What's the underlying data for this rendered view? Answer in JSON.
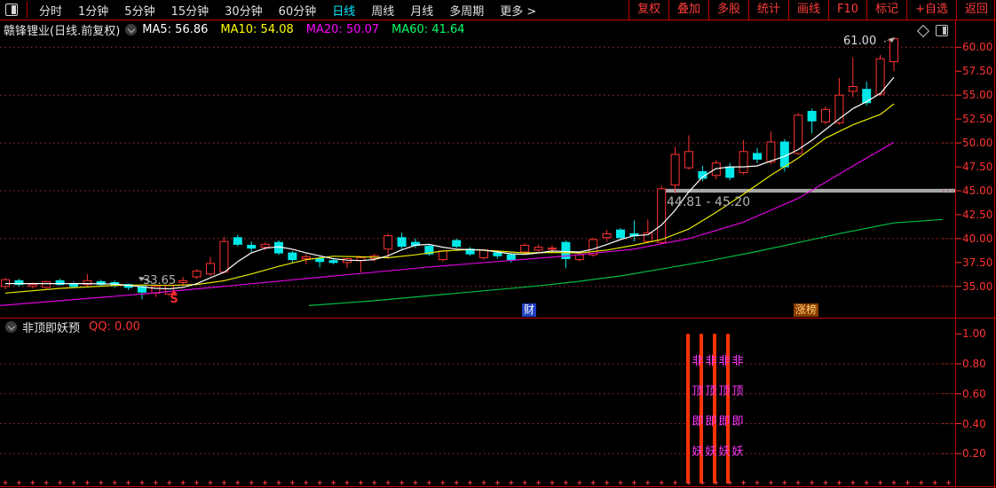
{
  "toolbar": {
    "periods": [
      "分时",
      "1分钟",
      "5分钟",
      "15分钟",
      "30分钟",
      "60分钟",
      "日线",
      "周线",
      "月线",
      "多周期",
      "更多 >"
    ],
    "active_period": "日线",
    "right_buttons": [
      "复权",
      "叠加",
      "多股",
      "统计",
      "画线",
      "F10",
      "标记",
      "+自选",
      "返回"
    ]
  },
  "header": {
    "title": "赣锋锂业(日线.前复权)",
    "ma_labels": [
      {
        "text": "MA5: 56.86",
        "color": "#ffffff"
      },
      {
        "text": "MA10: 54.08",
        "color": "#ffff00"
      },
      {
        "text": "MA20: 50.07",
        "color": "#ff00ff"
      },
      {
        "text": "MA60: 41.64",
        "color": "#00ff66"
      }
    ]
  },
  "main_chart": {
    "y_axis_labels": [
      "60.00",
      "57.50",
      "55.00",
      "52.50",
      "50.00",
      "47.50",
      "45.00",
      "42.50",
      "40.00",
      "37.50",
      "35.00"
    ],
    "y_axis_prices": [
      60,
      57.5,
      55,
      52.5,
      50,
      47.5,
      45,
      42.5,
      40,
      37.5,
      35
    ],
    "grid_prices": [
      60,
      55,
      50,
      45,
      40,
      35
    ],
    "annotations": {
      "low_label": "33.65",
      "sell_marker": "S",
      "band_label": "44.81 - 45.20",
      "band_price_top": 45.2,
      "band_price_bottom": 44.81,
      "high_label": "61.00",
      "badge_left": "财",
      "badge_right": "涨榜"
    }
  },
  "sub_chart": {
    "indicator_name": "非顶即妖预",
    "indicator_value": "QQ: 0.00",
    "y_axis_labels": [
      "1.00",
      "0.80",
      "0.60",
      "0.40",
      "0.20"
    ],
    "y_axis_values": [
      1.0,
      0.8,
      0.6,
      0.4,
      0.2
    ],
    "grid_values": [
      0.8,
      0.6,
      0.4,
      0.2
    ],
    "signal_text": "非顶即妖"
  },
  "chart_data": {
    "type": "candlestick",
    "title": "赣锋锂业 日线 前复权",
    "ylim_main": [
      33,
      62
    ],
    "ylim_sub": [
      0,
      1.1
    ],
    "up_color": "#ff3232",
    "down_color": "#00e8e8",
    "candles_ohlc": [
      [
        35.0,
        35.9,
        34.7,
        35.7
      ],
      [
        35.6,
        35.8,
        35.0,
        35.2
      ],
      [
        35.0,
        35.4,
        34.8,
        35.2
      ],
      [
        34.9,
        35.6,
        34.7,
        35.5
      ],
      [
        35.6,
        35.8,
        35.1,
        35.2
      ],
      [
        35.3,
        35.5,
        34.9,
        35.0
      ],
      [
        35.2,
        36.3,
        35.0,
        35.6
      ],
      [
        35.5,
        35.7,
        35.0,
        35.2
      ],
      [
        35.4,
        35.6,
        34.9,
        35.1
      ],
      [
        35.2,
        35.3,
        34.6,
        34.9
      ],
      [
        35.0,
        35.1,
        33.65,
        34.4
      ],
      [
        34.3,
        35.2,
        33.9,
        35.0
      ],
      [
        34.2,
        35.3,
        34.0,
        35.1
      ],
      [
        35.4,
        36.0,
        35.1,
        35.6
      ],
      [
        36.0,
        36.8,
        35.8,
        36.6
      ],
      [
        36.3,
        38.1,
        36.1,
        37.4
      ],
      [
        36.5,
        40.2,
        36.4,
        39.7
      ],
      [
        40.1,
        40.4,
        39.2,
        39.4
      ],
      [
        39.3,
        39.7,
        38.6,
        39.0
      ],
      [
        39.1,
        39.6,
        38.8,
        39.4
      ],
      [
        39.6,
        39.8,
        38.3,
        38.5
      ],
      [
        38.5,
        38.7,
        37.5,
        37.8
      ],
      [
        37.9,
        38.4,
        37.3,
        38.1
      ],
      [
        37.9,
        38.1,
        37.0,
        37.6
      ],
      [
        37.7,
        37.9,
        37.3,
        37.5
      ],
      [
        37.5,
        38.0,
        36.9,
        37.9
      ],
      [
        37.7,
        38.1,
        36.5,
        38.0
      ],
      [
        37.9,
        38.4,
        37.6,
        38.2
      ],
      [
        38.9,
        40.5,
        37.9,
        40.3
      ],
      [
        40.1,
        40.6,
        38.9,
        39.2
      ],
      [
        39.6,
        40.0,
        39.0,
        39.3
      ],
      [
        39.2,
        39.4,
        38.2,
        38.4
      ],
      [
        37.8,
        38.8,
        37.6,
        38.7
      ],
      [
        39.8,
        40.0,
        39.0,
        39.2
      ],
      [
        38.9,
        39.1,
        38.2,
        38.4
      ],
      [
        38.0,
        38.9,
        37.8,
        38.8
      ],
      [
        38.5,
        38.6,
        37.9,
        38.2
      ],
      [
        38.3,
        38.5,
        37.5,
        37.8
      ],
      [
        38.6,
        39.5,
        38.4,
        39.3
      ],
      [
        38.8,
        39.4,
        38.6,
        39.1
      ],
      [
        38.9,
        39.3,
        38.5,
        39.0
      ],
      [
        39.6,
        39.8,
        36.9,
        37.9
      ],
      [
        37.8,
        38.5,
        37.6,
        38.3
      ],
      [
        38.3,
        40.1,
        38.1,
        39.9
      ],
      [
        40.1,
        40.9,
        39.7,
        40.5
      ],
      [
        40.9,
        41.1,
        39.9,
        40.1
      ],
      [
        40.5,
        41.9,
        39.7,
        40.3
      ],
      [
        39.7,
        42.0,
        39.5,
        40.6
      ],
      [
        39.6,
        45.5,
        39.4,
        45.2
      ],
      [
        45.6,
        49.6,
        44.7,
        48.8
      ],
      [
        47.4,
        50.8,
        47.2,
        49.1
      ],
      [
        47.0,
        47.6,
        46.0,
        46.3
      ],
      [
        46.6,
        48.2,
        46.2,
        47.9
      ],
      [
        47.5,
        47.9,
        46.1,
        46.4
      ],
      [
        46.9,
        50.3,
        46.7,
        49.1
      ],
      [
        48.9,
        49.5,
        47.9,
        48.3
      ],
      [
        48.0,
        51.2,
        47.8,
        50.1
      ],
      [
        50.1,
        50.4,
        47.0,
        47.5
      ],
      [
        48.9,
        53.1,
        48.7,
        52.9
      ],
      [
        53.3,
        53.6,
        51.0,
        52.3
      ],
      [
        52.2,
        53.8,
        51.9,
        53.5
      ],
      [
        52.1,
        56.8,
        51.9,
        55.0
      ],
      [
        55.4,
        58.9,
        54.8,
        55.9
      ],
      [
        55.6,
        56.4,
        53.9,
        54.2
      ],
      [
        55.1,
        59.2,
        54.9,
        58.8
      ],
      [
        58.5,
        61.0,
        57.5,
        60.9
      ]
    ],
    "ma_series": [
      {
        "name": "MA60",
        "color": "#00bb44",
        "points": [
          [
            348,
            33.0
          ],
          [
            420,
            33.5
          ],
          [
            480,
            34.0
          ],
          [
            540,
            34.5
          ],
          [
            600,
            35.0
          ],
          [
            650,
            35.5
          ],
          [
            700,
            36.1
          ],
          [
            750,
            36.9
          ],
          [
            800,
            37.7
          ],
          [
            850,
            38.6
          ],
          [
            900,
            39.6
          ],
          [
            950,
            40.6
          ],
          [
            1007,
            41.64
          ],
          [
            1062,
            42.0
          ]
        ]
      },
      {
        "name": "MA20",
        "color": "#e000e0",
        "points": [
          [
            0,
            33.0
          ],
          [
            80,
            33.6
          ],
          [
            160,
            34.2
          ],
          [
            240,
            34.9
          ],
          [
            320,
            35.6
          ],
          [
            400,
            36.3
          ],
          [
            480,
            37.0
          ],
          [
            560,
            37.6
          ],
          [
            640,
            38.2
          ],
          [
            714,
            38.9
          ],
          [
            776,
            40.0
          ],
          [
            837,
            41.7
          ],
          [
            899,
            44.2
          ],
          [
            961,
            47.6
          ],
          [
            1007,
            50.07
          ]
        ]
      },
      {
        "name": "MA10",
        "color": "#e8e800",
        "points": [
          [
            6,
            34.3
          ],
          [
            68,
            34.8
          ],
          [
            129,
            35.1
          ],
          [
            160,
            35.15
          ],
          [
            191,
            35.1
          ],
          [
            222,
            35.2
          ],
          [
            253,
            35.6
          ],
          [
            283,
            36.3
          ],
          [
            314,
            37.1
          ],
          [
            345,
            37.8
          ],
          [
            375,
            38.15
          ],
          [
            406,
            38.1
          ],
          [
            437,
            38.0
          ],
          [
            468,
            38.3
          ],
          [
            499,
            38.7
          ],
          [
            529,
            38.85
          ],
          [
            560,
            38.7
          ],
          [
            591,
            38.5
          ],
          [
            622,
            38.55
          ],
          [
            653,
            38.5
          ],
          [
            684,
            38.8
          ],
          [
            714,
            39.3
          ],
          [
            745,
            39.9
          ],
          [
            776,
            41.0
          ],
          [
            806,
            42.7
          ],
          [
            837,
            44.6
          ],
          [
            868,
            46.6
          ],
          [
            899,
            48.4
          ],
          [
            930,
            50.5
          ],
          [
            961,
            51.9
          ],
          [
            992,
            53.0
          ],
          [
            1007,
            54.08
          ]
        ]
      },
      {
        "name": "MA5",
        "color": "#ffffff",
        "points": [
          [
            6,
            35.3
          ],
          [
            37,
            35.3
          ],
          [
            68,
            35.3
          ],
          [
            98,
            35.3
          ],
          [
            129,
            35.25
          ],
          [
            145,
            35.1
          ],
          [
            160,
            34.95
          ],
          [
            175,
            34.8
          ],
          [
            191,
            34.75
          ],
          [
            206,
            34.9
          ],
          [
            222,
            35.3
          ],
          [
            237,
            35.9
          ],
          [
            253,
            36.5
          ],
          [
            268,
            37.6
          ],
          [
            283,
            38.5
          ],
          [
            299,
            39.0
          ],
          [
            314,
            39.15
          ],
          [
            329,
            38.9
          ],
          [
            345,
            38.5
          ],
          [
            360,
            38.2
          ],
          [
            375,
            37.9
          ],
          [
            391,
            37.75
          ],
          [
            406,
            37.7
          ],
          [
            421,
            37.8
          ],
          [
            437,
            38.2
          ],
          [
            452,
            38.8
          ],
          [
            468,
            39.3
          ],
          [
            483,
            39.4
          ],
          [
            499,
            39.1
          ],
          [
            514,
            38.9
          ],
          [
            529,
            38.85
          ],
          [
            545,
            38.8
          ],
          [
            560,
            38.6
          ],
          [
            576,
            38.4
          ],
          [
            591,
            38.35
          ],
          [
            606,
            38.5
          ],
          [
            622,
            38.7
          ],
          [
            637,
            38.65
          ],
          [
            653,
            38.6
          ],
          [
            668,
            38.9
          ],
          [
            684,
            39.4
          ],
          [
            699,
            39.9
          ],
          [
            714,
            40.3
          ],
          [
            730,
            40.4
          ],
          [
            745,
            41.4
          ],
          [
            760,
            42.9
          ],
          [
            776,
            44.9
          ],
          [
            791,
            46.4
          ],
          [
            806,
            47.3
          ],
          [
            822,
            47.5
          ],
          [
            837,
            47.5
          ],
          [
            853,
            47.6
          ],
          [
            868,
            48.1
          ],
          [
            884,
            48.6
          ],
          [
            899,
            49.3
          ],
          [
            915,
            50.3
          ],
          [
            930,
            51.4
          ],
          [
            945,
            52.5
          ],
          [
            961,
            53.6
          ],
          [
            976,
            54.3
          ],
          [
            992,
            55.2
          ],
          [
            1007,
            56.86
          ]
        ]
      }
    ],
    "sub_bars": {
      "xs": [
        773,
        788,
        803,
        818
      ],
      "value": 1.0,
      "color": "#ff3300"
    },
    "signal_columns_x": [
      779,
      794,
      809,
      824
    ]
  }
}
